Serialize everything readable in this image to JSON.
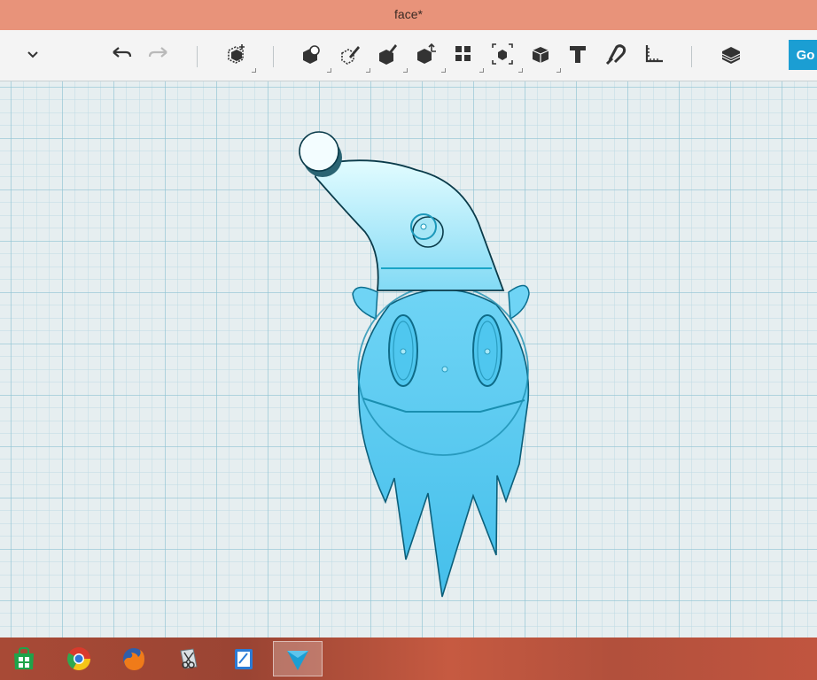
{
  "window": {
    "title": "face*"
  },
  "toolbar": {
    "go_label": "Go",
    "icons": [
      "collapse-chevron-icon",
      "undo-icon",
      "redo-icon",
      "add-shape-icon",
      "group-icon",
      "paint-icon",
      "hide-icon",
      "move-icon",
      "duplicate-icon",
      "align-icon",
      "flip-icon",
      "text-icon",
      "magnet-icon",
      "ruler-icon",
      "layers-icon"
    ]
  },
  "colors": {
    "titlebar": "#e8937a",
    "accent": "#1b9ed3",
    "shape_fill": "#5ccdf4",
    "hat_fill": "#b6eefa",
    "grid_minor": "#b9d9e3",
    "grid_major": "#8cc3d4"
  },
  "taskbar": {
    "apps": [
      "windows-store-icon",
      "chrome-icon",
      "firefox-icon",
      "snipping-tool-icon",
      "notes-icon",
      "tinkercad-icon"
    ]
  }
}
